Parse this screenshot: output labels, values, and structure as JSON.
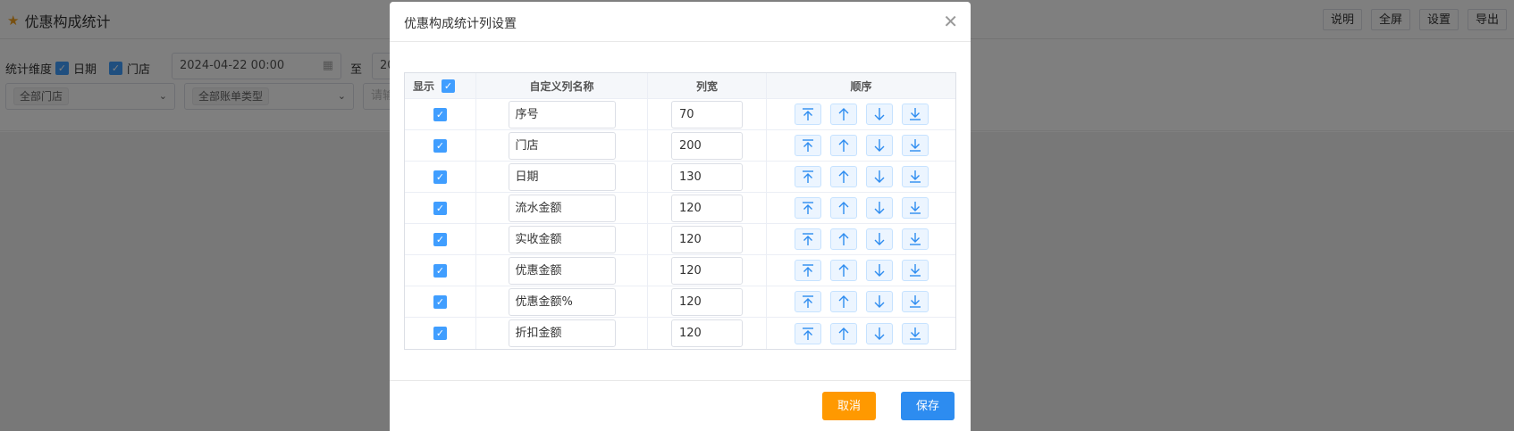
{
  "page": {
    "title": "优惠构成统计",
    "header_buttons": [
      "说明",
      "全屏",
      "设置",
      "导出"
    ]
  },
  "filters": {
    "dimension_label": "统计维度",
    "dim_date": "日期",
    "dim_store": "门店",
    "start_date": "2024-04-22 00:00",
    "to_label": "至",
    "end_date_partial": "20",
    "store_select": "全部门店",
    "bill_type_select": "全部账单类型",
    "third_placeholder": "请输"
  },
  "dialog": {
    "title": "优惠构成统计列设置",
    "columns": {
      "show": "显示",
      "name": "自定义列名称",
      "width": "列宽",
      "order": "顺序"
    },
    "rows": [
      {
        "name": "序号",
        "width": "70"
      },
      {
        "name": "门店",
        "width": "200"
      },
      {
        "name": "日期",
        "width": "130"
      },
      {
        "name": "流水金额",
        "width": "120"
      },
      {
        "name": "实收金额",
        "width": "120"
      },
      {
        "name": "优惠金额",
        "width": "120"
      },
      {
        "name": "优惠金额%",
        "width": "120"
      },
      {
        "name": "折扣金额",
        "width": "120"
      }
    ],
    "cancel_label": "取消",
    "save_label": "保存"
  },
  "colors": {
    "accent": "#409eff",
    "cancel": "#ff9900",
    "save": "#2d8cf0"
  }
}
